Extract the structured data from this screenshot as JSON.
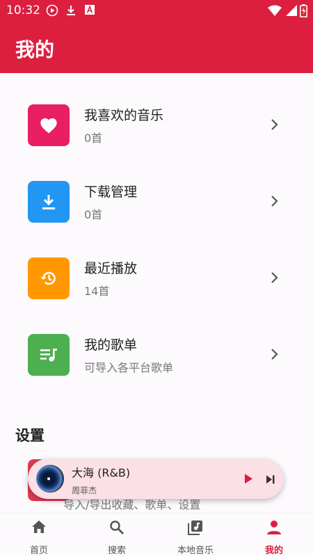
{
  "status_bar": {
    "time": "10:32"
  },
  "app_bar": {
    "title": "我的"
  },
  "menu": [
    {
      "name": "我喜欢的音乐",
      "sub": "0首",
      "color": "#e91e63",
      "icon": "heart-icon"
    },
    {
      "name": "下载管理",
      "sub": "0首",
      "color": "#2196f3",
      "icon": "download-icon"
    },
    {
      "name": "最近播放",
      "sub": "14首",
      "color": "#ff9800",
      "icon": "history-icon"
    },
    {
      "name": "我的歌单",
      "sub": "可导入各平台歌单",
      "color": "#4caf50",
      "icon": "playlist-icon"
    }
  ],
  "settings": {
    "title": "设置",
    "partial_item_sub": "导入/导出收藏、歌单、设置"
  },
  "player": {
    "song": "大海 (R&B)",
    "artist": "周菲杰"
  },
  "bottom_nav": [
    {
      "label": "首页",
      "icon": "home-icon",
      "active": false
    },
    {
      "label": "搜索",
      "icon": "search-icon",
      "active": false
    },
    {
      "label": "本地音乐",
      "icon": "local-music-icon",
      "active": false
    },
    {
      "label": "我的",
      "icon": "person-icon",
      "active": true
    }
  ],
  "colors": {
    "accent": "#dc1f3f"
  }
}
